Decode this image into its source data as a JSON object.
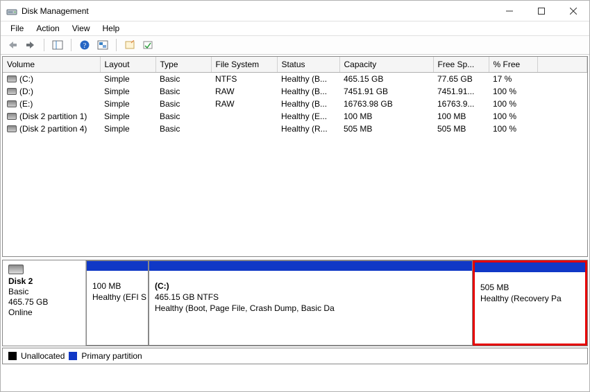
{
  "window": {
    "title": "Disk Management"
  },
  "menu": {
    "file": "File",
    "action": "Action",
    "view": "View",
    "help": "Help"
  },
  "columns": {
    "volume": "Volume",
    "layout": "Layout",
    "type": "Type",
    "filesystem": "File System",
    "status": "Status",
    "capacity": "Capacity",
    "freespace": "Free Sp...",
    "pctfree": "% Free"
  },
  "volumes": [
    {
      "name": "(C:)",
      "layout": "Simple",
      "type": "Basic",
      "fs": "NTFS",
      "status": "Healthy (B...",
      "capacity": "465.15 GB",
      "free": "77.65 GB",
      "pct": "17 %"
    },
    {
      "name": "(D:)",
      "layout": "Simple",
      "type": "Basic",
      "fs": "RAW",
      "status": "Healthy (B...",
      "capacity": "7451.91 GB",
      "free": "7451.91...",
      "pct": "100 %"
    },
    {
      "name": "(E:)",
      "layout": "Simple",
      "type": "Basic",
      "fs": "RAW",
      "status": "Healthy (B...",
      "capacity": "16763.98 GB",
      "free": "16763.9...",
      "pct": "100 %"
    },
    {
      "name": "(Disk 2 partition 1)",
      "layout": "Simple",
      "type": "Basic",
      "fs": "",
      "status": "Healthy (E...",
      "capacity": "100 MB",
      "free": "100 MB",
      "pct": "100 %"
    },
    {
      "name": "(Disk 2 partition 4)",
      "layout": "Simple",
      "type": "Basic",
      "fs": "",
      "status": "Healthy (R...",
      "capacity": "505 MB",
      "free": "505 MB",
      "pct": "100 %"
    }
  ],
  "disk": {
    "name": "Disk 2",
    "type": "Basic",
    "size": "465.75 GB",
    "state": "Online",
    "parts": [
      {
        "label": "",
        "size": "100 MB",
        "status": "Healthy (EFI S"
      },
      {
        "label": "(C:)",
        "size": "465.15 GB NTFS",
        "status": "Healthy (Boot, Page File, Crash Dump, Basic Da"
      },
      {
        "label": "",
        "size": "505 MB",
        "status": "Healthy (Recovery Pa"
      }
    ]
  },
  "legend": {
    "unallocated": "Unallocated",
    "primary": "Primary partition"
  }
}
